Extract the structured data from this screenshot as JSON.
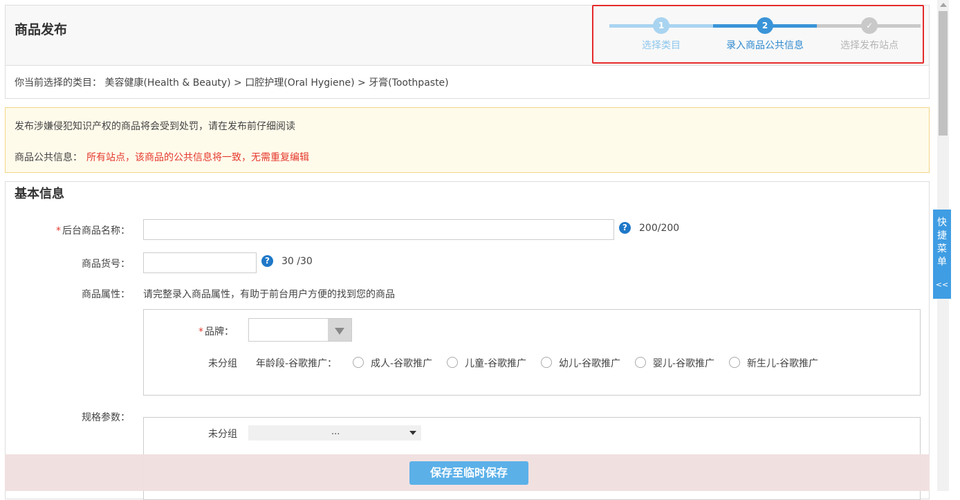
{
  "header": {
    "title": "商品发布"
  },
  "stepper": {
    "steps": [
      {
        "number": "1",
        "label": "选择类目"
      },
      {
        "number": "2",
        "label": "录入商品公共信息"
      },
      {
        "number": "✓",
        "label": "选择发布站点"
      }
    ],
    "colors": {
      "done": "#a9d4f0",
      "active": "#3a94d8",
      "pending": "#c9c9c9",
      "highlight": "#e52a2a"
    }
  },
  "category": {
    "prefix": "你当前选择的类目：",
    "path": "美容健康(Health & Beauty) > 口腔护理(Oral Hygiene) > 牙膏(Toothpaste)"
  },
  "notice": {
    "line1": "发布涉嫌侵犯知识产权的商品将会受到处罚，请在发布前仔细阅读",
    "line2_label": "商品公共信息：",
    "line2_text": "所有站点，该商品的公共信息将一致，无需重复编辑"
  },
  "basic_info": {
    "title": "基本信息",
    "fields": {
      "name": {
        "required_mark": "*",
        "label": "后台商品名称：",
        "value": "",
        "counter": "200/200"
      },
      "sku": {
        "label": "商品货号：",
        "value": "",
        "counter": "30 /30"
      },
      "attributes": {
        "label": "商品属性：",
        "hint": "请完整录入商品属性，有助于前台用户方便的找到您的商品"
      },
      "brand": {
        "required_mark": "*",
        "label": "品牌：",
        "value": ""
      },
      "age_group": {
        "group": "未分组",
        "label": "年龄段-谷歌推广：",
        "options": [
          "成人-谷歌推广",
          "儿童-谷歌推广",
          "幼儿-谷歌推广",
          "婴儿-谷歌推广",
          "新生儿-谷歌推广"
        ]
      },
      "specs": {
        "label": "规格参数：",
        "group": "未分组",
        "select_value": "..."
      }
    }
  },
  "footer": {
    "save_label": "保存至临时保存"
  },
  "quick_menu": {
    "label": "快捷菜单",
    "collapse": "<<"
  },
  "help_icon": "?"
}
